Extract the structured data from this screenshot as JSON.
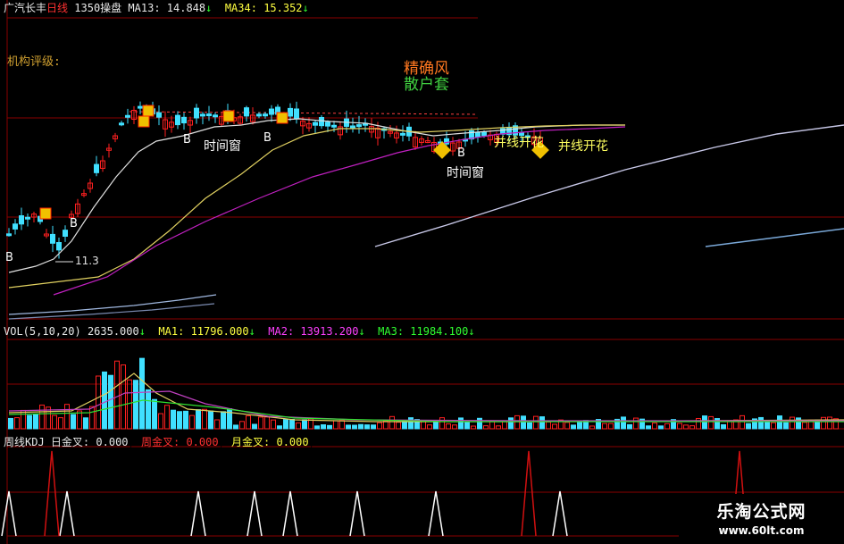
{
  "header": {
    "stock": "广汽长丰",
    "period": "日线",
    "code": "1350",
    "tag": "操盘",
    "ma13_label": "MA13:",
    "ma13_value": "14.848",
    "ma34_label": "MA34:",
    "ma34_value": "15.352",
    "arrow": "↓"
  },
  "panel_labels": {
    "rating": "机构评级:",
    "note1": "精确风",
    "note2": "散户套"
  },
  "annotations": {
    "b": "B",
    "window": "时间窗",
    "flower": "并线开花",
    "low": "11.3"
  },
  "volume": {
    "title": "VOL(5,10,20)",
    "value": "2635.000",
    "ma1_label": "MA1:",
    "ma1_value": "11796.000",
    "ma2_label": "MA2:",
    "ma2_value": "13913.200",
    "ma3_label": "MA3:",
    "ma3_value": "11984.100",
    "arrow": "↓"
  },
  "kdj": {
    "title": "周线KDJ",
    "day_label": "日金叉:",
    "day_value": "0.000",
    "week_label": "周金叉:",
    "week_value": "0.000",
    "month_label": "月金叉:",
    "month_value": "0.000"
  },
  "watermark": {
    "title": "乐淘公式网",
    "url": "www.60lt.com"
  },
  "colors": {
    "up": "#ff2020",
    "down": "#40e0ff",
    "ma13": "#e0e0e0",
    "ma34": "#e0d060",
    "ma_magenta": "#c020c0",
    "grid": "#8a0000",
    "signal_red": "#d01010",
    "signal_white": "#ffffff"
  },
  "chart_data": [
    {
      "type": "candlestick",
      "title": "广汽长丰 日线",
      "indicators": [
        "MA13",
        "MA34"
      ],
      "series": [
        {
          "name": "MA13",
          "last": 14.848
        },
        {
          "name": "MA34",
          "last": 15.352
        }
      ],
      "annotations": [
        "B",
        "时间窗",
        "并线开花",
        "11.3"
      ]
    },
    {
      "type": "bar",
      "title": "VOL(5,10,20)",
      "series": [
        {
          "name": "VOL",
          "last": 2635.0
        },
        {
          "name": "MA1",
          "last": 11796.0
        },
        {
          "name": "MA2",
          "last": 13913.2
        },
        {
          "name": "MA3",
          "last": 11984.1
        }
      ]
    },
    {
      "type": "line",
      "title": "周线KDJ",
      "series": [
        {
          "name": "日金叉",
          "last": 0.0
        },
        {
          "name": "周金叉",
          "last": 0.0
        },
        {
          "name": "月金叉",
          "last": 0.0
        }
      ]
    }
  ]
}
